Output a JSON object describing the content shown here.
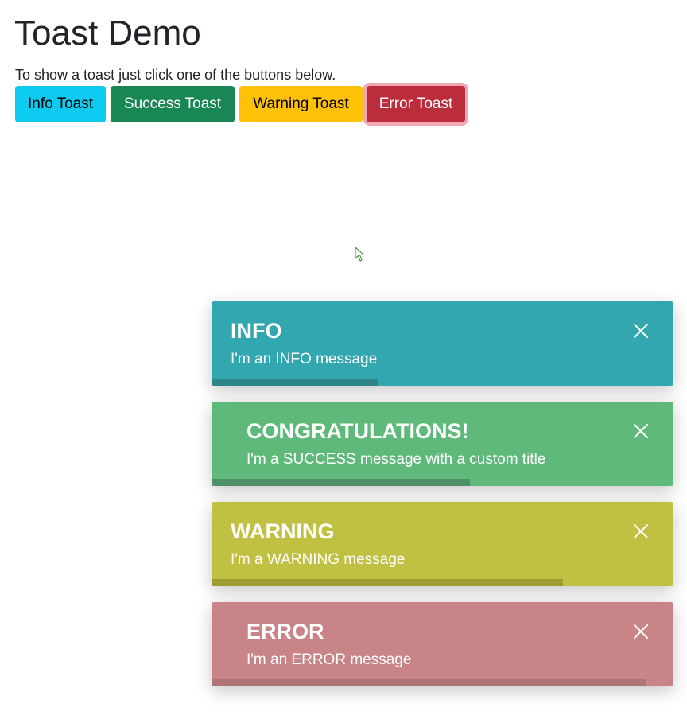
{
  "page": {
    "title": "Toast Demo",
    "intro": "To show a toast just click one of the buttons below."
  },
  "buttons": [
    {
      "label": "Info Toast",
      "color": "#0dcaf0"
    },
    {
      "label": "Success Toast",
      "color": "#198754"
    },
    {
      "label": "Warning Toast",
      "color": "#ffc107"
    },
    {
      "label": "Error Toast",
      "color": "#bb2d3b"
    }
  ],
  "toasts": [
    {
      "title": "INFO",
      "message": "I'm an INFO message",
      "color": "#33a7af",
      "progress": 0.36,
      "close_icon": "close-icon"
    },
    {
      "title": "CONGRATULATIONS!",
      "message": "I'm a SUCCESS message with a custom title",
      "color": "#5fb97a",
      "progress": 0.56,
      "close_icon": "close-icon"
    },
    {
      "title": "WARNING",
      "message": "I'm a WARNING message",
      "color": "#c0c142",
      "progress": 0.76,
      "close_icon": "close-icon"
    },
    {
      "title": "ERROR",
      "message": "I'm an ERROR message",
      "color": "#c98487",
      "progress": 0.94,
      "close_icon": "close-icon"
    }
  ]
}
